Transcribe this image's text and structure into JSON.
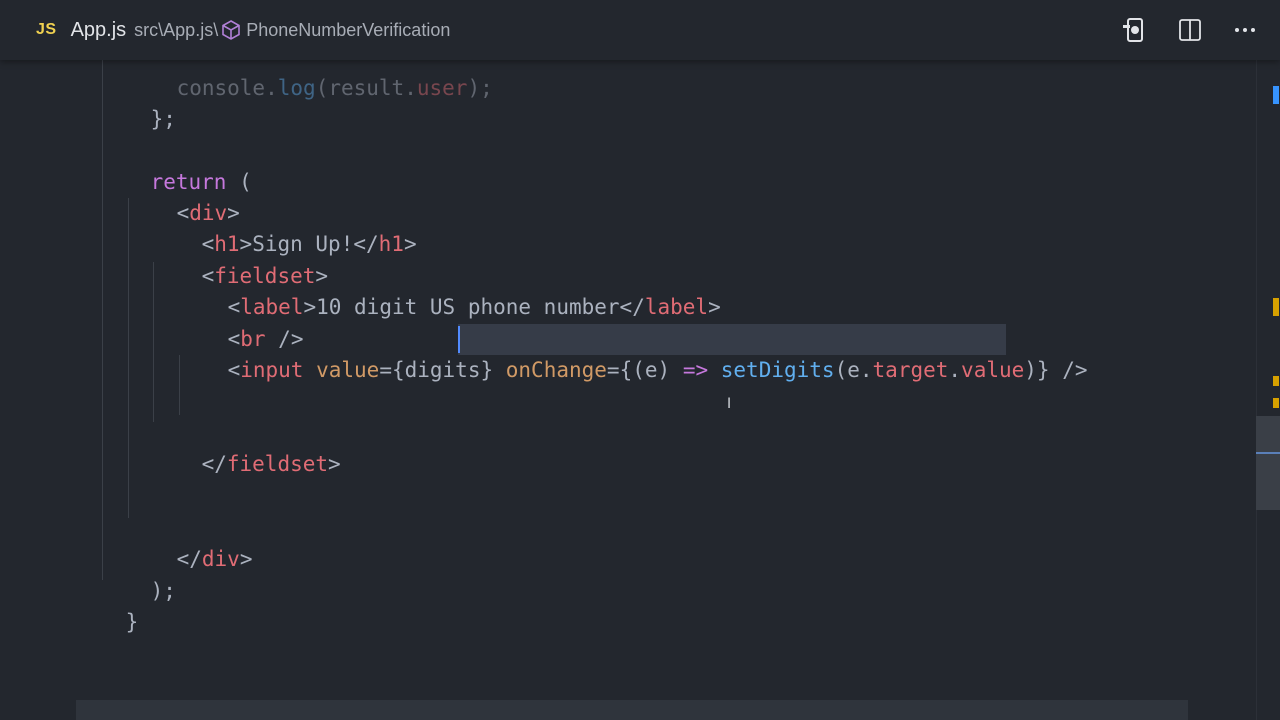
{
  "breadcrumb": {
    "language_badge": "JS",
    "file_name": "App.js",
    "path": "src\\App.js",
    "separator": "\\",
    "symbol": "PhoneNumberVerification"
  },
  "actions": {
    "icons": [
      "open-preview-icon",
      "split-editor-icon",
      "more-actions-icon"
    ]
  },
  "colors": {
    "background": "#23272e",
    "keyword": "#c678dd",
    "tag": "#e06c75",
    "attribute": "#d19a66",
    "function": "#61afef",
    "text": "#abb2bf",
    "js_badge": "#f0d150"
  },
  "code": {
    "line_partial": [
      "console",
      ".",
      "log",
      "(",
      "result",
      ".",
      "user",
      ");"
    ],
    "line_close_fn": "};",
    "line_return": [
      "return",
      " ("
    ],
    "line_div_open": [
      "<",
      "div",
      ">"
    ],
    "line_h1": [
      "<",
      "h1",
      ">",
      "Sign Up!",
      "</",
      "h1",
      ">"
    ],
    "line_fieldset_open": [
      "<",
      "fieldset",
      ">"
    ],
    "line_label": [
      "<",
      "label",
      ">",
      "10 digit US phone number",
      "</",
      "label",
      ">"
    ],
    "line_br": [
      "<",
      "br",
      " />"
    ],
    "line_input": [
      "<",
      "input",
      " value",
      "={",
      "digits",
      "} ",
      "onChange",
      "={(",
      "e",
      ") ",
      "=>",
      " ",
      "setDigits",
      "(",
      "e",
      ".",
      "target",
      ".",
      "value",
      ")} />"
    ],
    "line_fieldset_close": [
      "</",
      "fieldset",
      ">"
    ],
    "line_div_close": [
      "</",
      "div",
      ">"
    ],
    "line_paren_close": ");",
    "line_brace_close": "}"
  },
  "cursor_glyph": "I"
}
